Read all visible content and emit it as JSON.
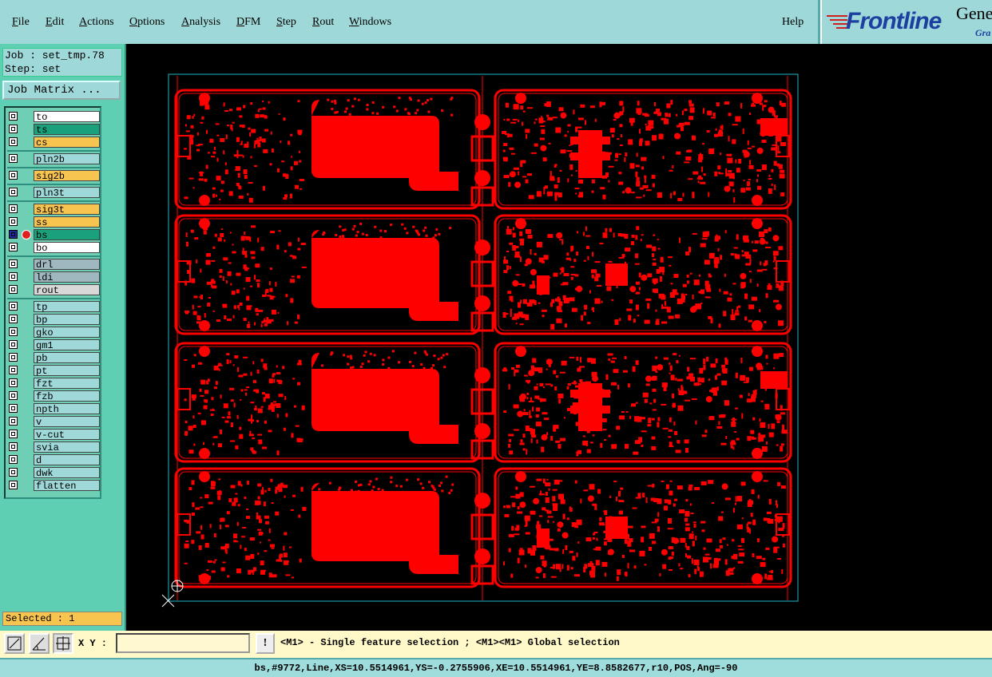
{
  "menu": {
    "file": "File",
    "edit": "Edit",
    "actions": "Actions",
    "options": "Options",
    "analysis": "Analysis",
    "dfm": "DFM",
    "step": "Step",
    "rout": "Rout",
    "windows": "Windows",
    "help": "Help"
  },
  "brand": {
    "logo": "Frontline",
    "product": "Gene",
    "subtitle": "Gra"
  },
  "job": {
    "job_line": "Job : set_tmp.78",
    "step_line": "Step: set"
  },
  "job_matrix_label": "Job Matrix ...",
  "layers": [
    {
      "name": "to",
      "color": "#ffffff",
      "active": false
    },
    {
      "name": "ts",
      "color": "#1aa07a",
      "active": false
    },
    {
      "name": "cs",
      "color": "#f8c450",
      "active": false
    },
    {
      "name": "pln2b",
      "color": "#9fd8d8",
      "active": false
    },
    {
      "name": "sig2b",
      "color": "#f8c450",
      "active": false
    },
    {
      "name": "pln3t",
      "color": "#9fd8d8",
      "active": false
    },
    {
      "name": "sig3t",
      "color": "#f8c450",
      "active": false
    },
    {
      "name": "ss",
      "color": "#f8c450",
      "active": false
    },
    {
      "name": "bs",
      "color": "#1aa07a",
      "active": true
    },
    {
      "name": "bo",
      "color": "#ffffff",
      "active": false
    },
    {
      "name": "drl",
      "color": "#9fb8c0",
      "active": false
    },
    {
      "name": "ldi",
      "color": "#9fb8c0",
      "active": false
    },
    {
      "name": "rout",
      "color": "#d8d8d8",
      "active": false
    },
    {
      "name": "tp",
      "color": "#9fd8d8",
      "active": false
    },
    {
      "name": "bp",
      "color": "#9fd8d8",
      "active": false
    },
    {
      "name": "gko",
      "color": "#9fd8d8",
      "active": false
    },
    {
      "name": "gm1",
      "color": "#9fd8d8",
      "active": false
    },
    {
      "name": "pb",
      "color": "#9fd8d8",
      "active": false
    },
    {
      "name": "pt",
      "color": "#9fd8d8",
      "active": false
    },
    {
      "name": "fzt",
      "color": "#9fd8d8",
      "active": false
    },
    {
      "name": "fzb",
      "color": "#9fd8d8",
      "active": false
    },
    {
      "name": "npth",
      "color": "#9fd8d8",
      "active": false
    },
    {
      "name": "v",
      "color": "#9fd8d8",
      "active": false
    },
    {
      "name": "v-cut",
      "color": "#9fd8d8",
      "active": false
    },
    {
      "name": "svia",
      "color": "#9fd8d8",
      "active": false
    },
    {
      "name": "d",
      "color": "#9fd8d8",
      "active": false
    },
    {
      "name": "dwk",
      "color": "#9fd8d8",
      "active": false
    },
    {
      "name": "flatten",
      "color": "#9fd8d8",
      "active": false
    }
  ],
  "selected_text": "Selected : 1",
  "xy_label": "X Y :",
  "xy_value": "",
  "hint": "<M1> - Single feature selection ; <M1><M1> Global selection",
  "status": "bs,#9772,Line,XS=10.5514961,YS=-0.2755906,XE=10.5514961,YE=8.8582677,r10,POS,Ang=-90",
  "colors": {
    "copper": "#ff0000",
    "outline": "#20b8c8",
    "panel": "#5fcfb4",
    "menubar": "#9fd8d8"
  }
}
